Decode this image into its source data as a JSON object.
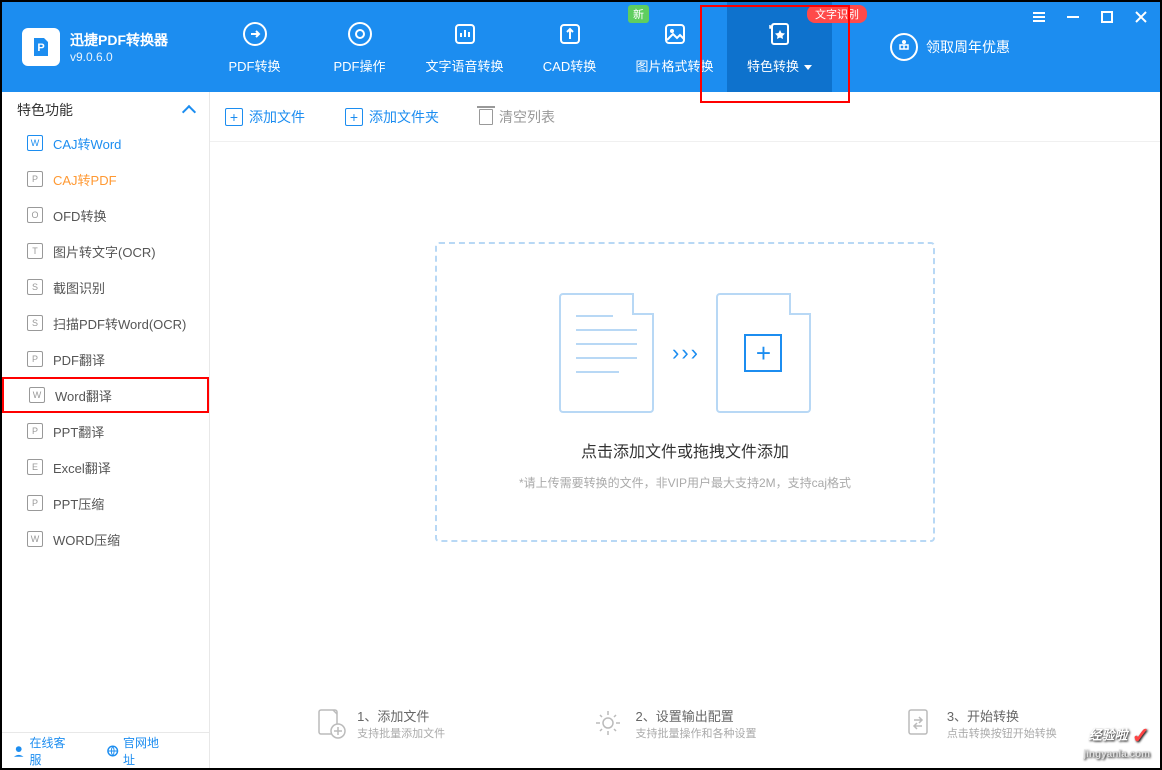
{
  "app": {
    "title": "迅捷PDF转换器",
    "version": "v9.0.6.0"
  },
  "header_tabs": [
    {
      "label": "PDF转换"
    },
    {
      "label": "PDF操作"
    },
    {
      "label": "文字语音转换"
    },
    {
      "label": "CAD转换"
    },
    {
      "label": "图片格式转换",
      "badge_new": "新"
    },
    {
      "label": "特色转换",
      "active": true,
      "badge_text": "文字识别"
    }
  ],
  "reward_label": "领取周年优惠",
  "sidebar": {
    "section_title": "特色功能",
    "items": [
      {
        "label": "CAJ转Word",
        "icon": "W",
        "blue": true
      },
      {
        "label": "CAJ转PDF",
        "icon": "P",
        "active": true
      },
      {
        "label": "OFD转换",
        "icon": "O"
      },
      {
        "label": "图片转文字(OCR)",
        "icon": "T"
      },
      {
        "label": "截图识别",
        "icon": "S"
      },
      {
        "label": "扫描PDF转Word(OCR)",
        "icon": "S"
      },
      {
        "label": "PDF翻译",
        "icon": "P"
      },
      {
        "label": "Word翻译",
        "icon": "W",
        "red_box": true
      },
      {
        "label": "PPT翻译",
        "icon": "P"
      },
      {
        "label": "Excel翻译",
        "icon": "E"
      },
      {
        "label": "PPT压缩",
        "icon": "P"
      },
      {
        "label": "WORD压缩",
        "icon": "W"
      }
    ],
    "footer": {
      "service": "在线客服",
      "website": "官网地址"
    }
  },
  "toolbar": {
    "add_file": "添加文件",
    "add_folder": "添加文件夹",
    "clear_list": "清空列表"
  },
  "dropzone": {
    "title": "点击添加文件或拖拽文件添加",
    "hint": "*请上传需要转换的文件，非VIP用户最大支持2M，支持caj格式"
  },
  "steps": [
    {
      "num": "1、",
      "title": "添加文件",
      "sub": "支持批量添加文件"
    },
    {
      "num": "2、",
      "title": "设置输出配置",
      "sub": "支持批量操作和各种设置"
    },
    {
      "num": "3、",
      "title": "开始转换",
      "sub": "点击转换按钮开始转换"
    }
  ],
  "watermark": {
    "name": "经验啦",
    "url": "jingyanla.com"
  }
}
